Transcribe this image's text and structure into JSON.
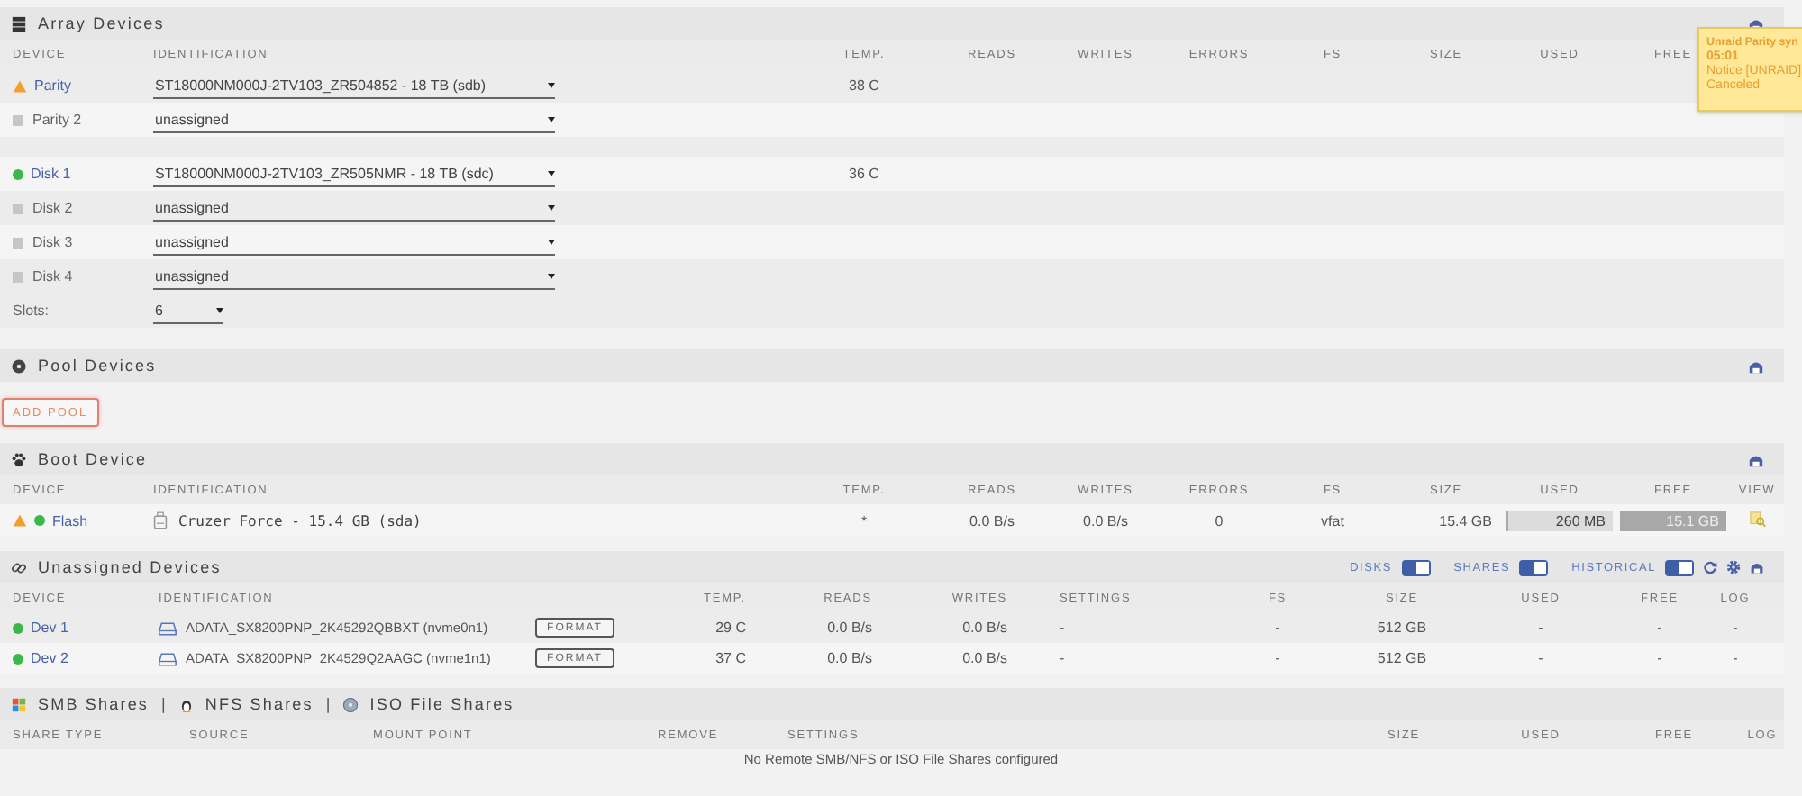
{
  "notification": {
    "title": "Unraid Parity syn",
    "time": "05:01",
    "source": "Notice [UNRAID]",
    "message": "Canceled"
  },
  "array": {
    "title": "Array Devices",
    "columns": [
      "DEVICE",
      "IDENTIFICATION",
      "TEMP.",
      "READS",
      "WRITES",
      "ERRORS",
      "FS",
      "SIZE",
      "USED",
      "FREE"
    ],
    "groups": [
      [
        {
          "device": "Parity",
          "kind": "warning",
          "identification": "ST18000NM000J-2TV103_ZR504852 - 18 TB (sdb)",
          "temp": "38 C"
        },
        {
          "device": "Parity 2",
          "kind": "empty",
          "identification": "unassigned"
        }
      ],
      [
        {
          "device": "Disk 1",
          "kind": "ok",
          "identification": "ST18000NM000J-2TV103_ZR505NMR - 18 TB (sdc)",
          "temp": "36 C"
        },
        {
          "device": "Disk 2",
          "kind": "empty",
          "identification": "unassigned"
        },
        {
          "device": "Disk 3",
          "kind": "empty",
          "identification": "unassigned"
        },
        {
          "device": "Disk 4",
          "kind": "empty",
          "identification": "unassigned"
        }
      ]
    ],
    "slots": {
      "label": "Slots:",
      "value": "6"
    }
  },
  "pool": {
    "title": "Pool Devices",
    "button": "ADD POOL"
  },
  "boot": {
    "title": "Boot Device",
    "columns": [
      "DEVICE",
      "IDENTIFICATION",
      "TEMP.",
      "READS",
      "WRITES",
      "ERRORS",
      "FS",
      "SIZE",
      "USED",
      "FREE",
      "VIEW"
    ],
    "rows": [
      {
        "device": "Flash",
        "indicators": [
          {
            "kind": "warning"
          },
          {
            "kind": "ok"
          }
        ],
        "identification": "Cruzer_Force - 15.4 GB (sda)",
        "temp": "*",
        "reads": "0.0 B/s",
        "writes": "0.0 B/s",
        "errors": "0",
        "fs": "vfat",
        "size": "15.4 GB",
        "used": "260 MB",
        "free": "15.1 GB"
      }
    ]
  },
  "unassigned": {
    "title": "Unassigned Devices",
    "toggles": [
      {
        "label": "DISKS",
        "on": true
      },
      {
        "label": "SHARES",
        "on": true
      },
      {
        "label": "HISTORICAL",
        "on": true
      }
    ],
    "columns": [
      "DEVICE",
      "IDENTIFICATION",
      "TEMP.",
      "READS",
      "WRITES",
      "SETTINGS",
      "FS",
      "SIZE",
      "USED",
      "FREE",
      "LOG"
    ],
    "rows": [
      {
        "device": "Dev 1",
        "kind": "ok",
        "identification": "ADATA_SX8200PNP_2K45292QBBXT (nvme0n1)",
        "button": "FORMAT",
        "temp": "29 C",
        "reads": "0.0 B/s",
        "writes": "0.0 B/s",
        "settings": "-",
        "fs": "-",
        "size": "512 GB",
        "used": "-",
        "free": "-",
        "log": "-"
      },
      {
        "device": "Dev 2",
        "kind": "ok",
        "identification": "ADATA_SX8200PNP_2K4529Q2AAGC (nvme1n1)",
        "button": "FORMAT",
        "temp": "37 C",
        "reads": "0.0 B/s",
        "writes": "0.0 B/s",
        "settings": "-",
        "fs": "-",
        "size": "512 GB",
        "used": "-",
        "free": "-",
        "log": "-"
      }
    ]
  },
  "shares": {
    "tabs": [
      {
        "label": "SMB Shares",
        "kind": "smb"
      },
      {
        "label": "NFS Shares",
        "kind": "nfs"
      },
      {
        "label": "ISO File Shares",
        "kind": "iso"
      }
    ],
    "separators": [
      "|",
      "|"
    ],
    "columns": [
      "SHARE TYPE",
      "SOURCE",
      "MOUNT POINT",
      "REMOVE",
      "SETTINGS",
      "SIZE",
      "USED",
      "FREE",
      "LOG"
    ],
    "message": "No Remote SMB/NFS or ISO File Shares configured"
  }
}
